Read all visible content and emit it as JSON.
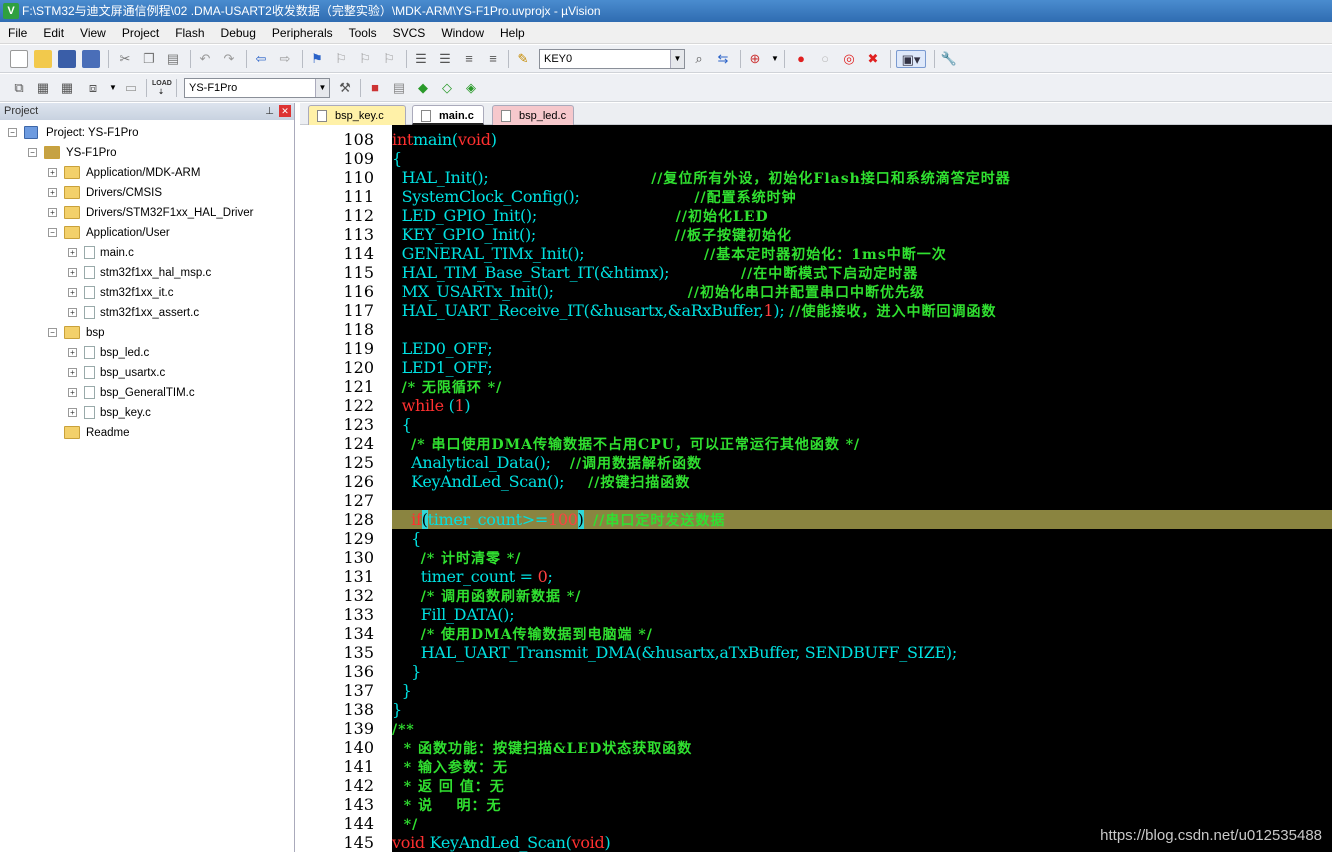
{
  "window": {
    "title": "F:\\STM32与迪文屏通信例程\\02 .DMA-USART2收发数据（完整实验）\\MDK-ARM\\YS-F1Pro.uvprojx - µVision"
  },
  "menu": [
    "File",
    "Edit",
    "View",
    "Project",
    "Flash",
    "Debug",
    "Peripherals",
    "Tools",
    "SVCS",
    "Window",
    "Help"
  ],
  "toolbar": {
    "find_combo": "KEY0",
    "target_combo": "YS-F1Pro"
  },
  "project_pane": {
    "title": "Project",
    "tree": [
      {
        "label": "Project: YS-F1Pro",
        "level": 0,
        "kind": "project",
        "exp": "-"
      },
      {
        "label": "YS-F1Pro",
        "level": 1,
        "kind": "target",
        "exp": "-"
      },
      {
        "label": "Application/MDK-ARM",
        "level": 2,
        "kind": "folder",
        "exp": "+"
      },
      {
        "label": "Drivers/CMSIS",
        "level": 2,
        "kind": "folder",
        "exp": "+"
      },
      {
        "label": "Drivers/STM32F1xx_HAL_Driver",
        "level": 2,
        "kind": "folder",
        "exp": "+"
      },
      {
        "label": "Application/User",
        "level": 2,
        "kind": "folder",
        "exp": "-"
      },
      {
        "label": "main.c",
        "level": 3,
        "kind": "file",
        "exp": "+"
      },
      {
        "label": "stm32f1xx_hal_msp.c",
        "level": 3,
        "kind": "file",
        "exp": "+"
      },
      {
        "label": "stm32f1xx_it.c",
        "level": 3,
        "kind": "file",
        "exp": "+"
      },
      {
        "label": "stm32f1xx_assert.c",
        "level": 3,
        "kind": "file",
        "exp": "+"
      },
      {
        "label": "bsp",
        "level": 2,
        "kind": "folder",
        "exp": "-"
      },
      {
        "label": "bsp_led.c",
        "level": 3,
        "kind": "file",
        "exp": "+"
      },
      {
        "label": "bsp_usartx.c",
        "level": 3,
        "kind": "file",
        "exp": "+"
      },
      {
        "label": "bsp_GeneralTIM.c",
        "level": 3,
        "kind": "file",
        "exp": "+"
      },
      {
        "label": "bsp_key.c",
        "level": 3,
        "kind": "file",
        "exp": "+"
      },
      {
        "label": "Readme",
        "level": 2,
        "kind": "folder",
        "exp": ""
      }
    ]
  },
  "tabs": [
    {
      "label": "bsp_key.c",
      "active": false
    },
    {
      "label": "main.c",
      "active": true
    },
    {
      "label": "bsp_led.c",
      "active": false
    }
  ],
  "editor": {
    "highlight_line": 128,
    "lines": [
      {
        "n": "108",
        "fold": "",
        "segs": [
          [
            "kw",
            "int"
          ],
          [
            "",
            "main"
          ],
          [
            "",
            "("
          ],
          [
            "kw",
            "void"
          ],
          [
            "",
            ")"
          ]
        ]
      },
      {
        "n": "109",
        "fold": "-",
        "segs": [
          [
            "",
            "{"
          ]
        ]
      },
      {
        "n": "110",
        "fold": "",
        "segs": [
          [
            "",
            "  HAL_Init();                                  "
          ],
          [
            "cm",
            "//复位所有外设，初始化Flash接口和系统滴答定时器"
          ]
        ]
      },
      {
        "n": "111",
        "fold": "",
        "segs": [
          [
            "",
            "  SystemClock_Config();                        "
          ],
          [
            "cm",
            "//配置系统时钟"
          ]
        ]
      },
      {
        "n": "112",
        "fold": "",
        "segs": [
          [
            "",
            "  LED_GPIO_Init();                             "
          ],
          [
            "cm",
            "//初始化LED"
          ]
        ]
      },
      {
        "n": "113",
        "fold": "",
        "segs": [
          [
            "",
            "  KEY_GPIO_Init();                             "
          ],
          [
            "cm",
            "//板子按键初始化"
          ]
        ]
      },
      {
        "n": "114",
        "fold": "",
        "segs": [
          [
            "",
            "  GENERAL_TIMx_Init();                         "
          ],
          [
            "cm",
            "//基本定时器初始化：1ms中断一次"
          ]
        ]
      },
      {
        "n": "115",
        "fold": "",
        "segs": [
          [
            "",
            "  HAL_TIM_Base_Start_IT(&htimx);               "
          ],
          [
            "cm",
            "//在中断模式下启动定时器"
          ]
        ]
      },
      {
        "n": "116",
        "fold": "",
        "segs": [
          [
            "",
            "  MX_USARTx_Init();                            "
          ],
          [
            "cm",
            "//初始化串口并配置串口中断优先级"
          ]
        ]
      },
      {
        "n": "117",
        "fold": "",
        "segs": [
          [
            "",
            "  HAL_UART_Receive_IT(&husartx,&aRxBuffer,"
          ],
          [
            "nm",
            "1"
          ],
          [
            "",
            "); "
          ],
          [
            "cm",
            "//使能接收，进入中断回调函数"
          ]
        ]
      },
      {
        "n": "118",
        "fold": "",
        "segs": [
          [
            "",
            ""
          ]
        ]
      },
      {
        "n": "119",
        "fold": "",
        "segs": [
          [
            "",
            "  LED0_OFF;"
          ]
        ]
      },
      {
        "n": "120",
        "fold": "",
        "segs": [
          [
            "",
            "  LED1_OFF;"
          ]
        ]
      },
      {
        "n": "121",
        "fold": "",
        "segs": [
          [
            "",
            "  "
          ],
          [
            "cm",
            "/* 无限循环 */"
          ]
        ]
      },
      {
        "n": "122",
        "fold": "",
        "segs": [
          [
            "",
            "  "
          ],
          [
            "kw",
            "while"
          ],
          [
            "",
            " ("
          ],
          [
            "nm",
            "1"
          ],
          [
            "",
            ")"
          ]
        ]
      },
      {
        "n": "123",
        "fold": "-",
        "segs": [
          [
            "",
            "  {"
          ]
        ]
      },
      {
        "n": "124",
        "fold": "",
        "segs": [
          [
            "",
            "    "
          ],
          [
            "cm",
            "/* 串口使用DMA传输数据不占用CPU，可以正常运行其他函数 */"
          ]
        ]
      },
      {
        "n": "125",
        "fold": "",
        "segs": [
          [
            "",
            "    Analytical_Data();    "
          ],
          [
            "cm",
            "//调用数据解析函数"
          ]
        ]
      },
      {
        "n": "126",
        "fold": "",
        "segs": [
          [
            "",
            "    KeyAndLed_Scan();     "
          ],
          [
            "cm",
            "//按键扫描函数"
          ]
        ]
      },
      {
        "n": "127",
        "fold": "",
        "segs": [
          [
            "",
            ""
          ]
        ]
      },
      {
        "n": "128",
        "fold": "",
        "segs": [
          [
            "",
            "    "
          ],
          [
            "kw",
            "if"
          ],
          [
            "br",
            "("
          ],
          [
            "",
            "timer_count>="
          ],
          [
            "nm",
            "100"
          ],
          [
            "br",
            ")"
          ],
          [
            "",
            "  "
          ],
          [
            "cm",
            "//串口定时发送数据"
          ]
        ]
      },
      {
        "n": "129",
        "fold": "-",
        "segs": [
          [
            "",
            "    {"
          ]
        ]
      },
      {
        "n": "130",
        "fold": "",
        "segs": [
          [
            "",
            "      "
          ],
          [
            "cm",
            "/* 计时清零 */"
          ]
        ]
      },
      {
        "n": "131",
        "fold": "",
        "segs": [
          [
            "",
            "      timer_count = "
          ],
          [
            "nm",
            "0"
          ],
          [
            "",
            ";"
          ]
        ]
      },
      {
        "n": "132",
        "fold": "",
        "segs": [
          [
            "",
            "      "
          ],
          [
            "cm",
            "/* 调用函数刷新数据 */"
          ]
        ]
      },
      {
        "n": "133",
        "fold": "",
        "segs": [
          [
            "",
            "      Fill_DATA();"
          ]
        ]
      },
      {
        "n": "134",
        "fold": "",
        "segs": [
          [
            "",
            "      "
          ],
          [
            "cm",
            "/* 使用DMA传输数据到电脑端 */"
          ]
        ]
      },
      {
        "n": "135",
        "fold": "",
        "segs": [
          [
            "",
            "      HAL_UART_Transmit_DMA(&husartx,aTxBuffer, SENDBUFF_SIZE);"
          ]
        ]
      },
      {
        "n": "136",
        "fold": "",
        "segs": [
          [
            "",
            "    }"
          ]
        ]
      },
      {
        "n": "137",
        "fold": "",
        "segs": [
          [
            "",
            "  }"
          ]
        ]
      },
      {
        "n": "138",
        "fold": "",
        "segs": [
          [
            "",
            "}"
          ]
        ]
      },
      {
        "n": "139",
        "fold": "-",
        "segs": [
          [
            "cm",
            "/**"
          ]
        ]
      },
      {
        "n": "140",
        "fold": "",
        "segs": [
          [
            "cm",
            "  * 函数功能：按键扫描&LED状态获取函数"
          ]
        ]
      },
      {
        "n": "141",
        "fold": "",
        "segs": [
          [
            "cm",
            "  * 输入参数：无"
          ]
        ]
      },
      {
        "n": "142",
        "fold": "",
        "segs": [
          [
            "cm",
            "  * 返 回 值：无"
          ]
        ]
      },
      {
        "n": "143",
        "fold": "",
        "segs": [
          [
            "cm",
            "  * 说    明：无"
          ]
        ]
      },
      {
        "n": "144",
        "fold": "",
        "segs": [
          [
            "cm",
            "  */"
          ]
        ]
      },
      {
        "n": "145",
        "fold": "",
        "segs": [
          [
            "kw",
            "void"
          ],
          [
            "",
            " KeyAndLed_Scan("
          ],
          [
            "kw",
            "void"
          ],
          [
            "",
            ")"
          ]
        ]
      }
    ]
  },
  "watermark": "https://blog.csdn.net/u012535488"
}
